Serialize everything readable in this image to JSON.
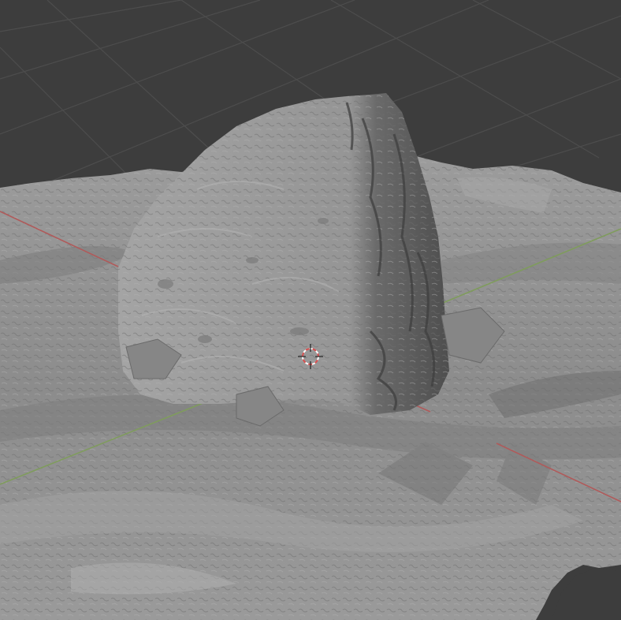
{
  "viewport": {
    "background_color": "#3d3d3d",
    "grid_color": "#4c4c4c",
    "x_axis_color": "#b05a5a",
    "y_axis_color": "#7e9a5a"
  },
  "scene": {
    "ground_mesh_color": "#8d8d8d",
    "rock_mesh_color": "#9a9a9a",
    "rock_shadow_color": "#5a5a5a"
  },
  "cursor": {
    "icon": "3d-cursor-icon",
    "ring_colors": [
      "#d85050",
      "#ffffff"
    ]
  }
}
